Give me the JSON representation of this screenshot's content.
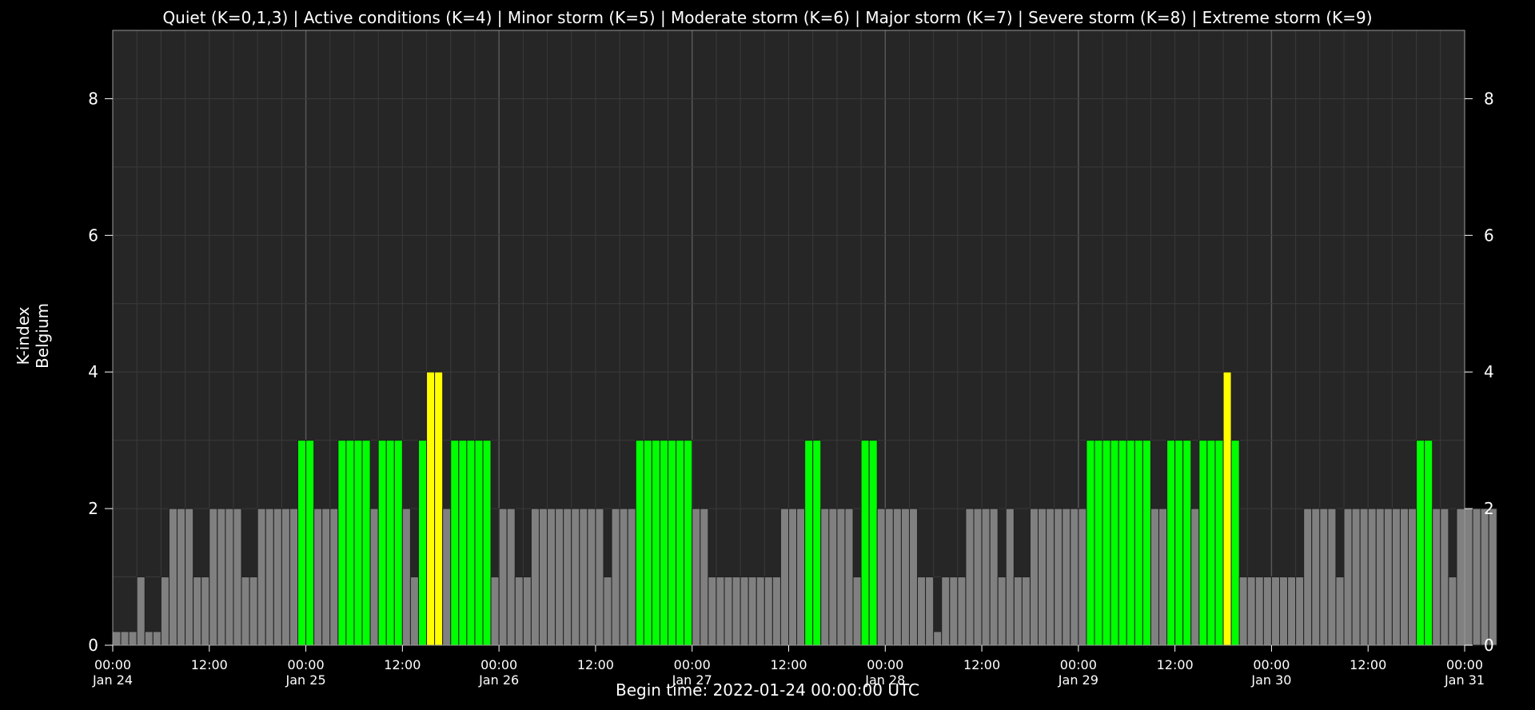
{
  "chart_data": {
    "type": "bar",
    "title": "Quiet (K=0,1,3) | Active conditions (K=4) | Minor storm (K=5) | Moderate storm (K=6) | Major storm (K=7) | Severe storm (K=8) | Extreme storm (K=9)",
    "ylabel_line1": "K-index",
    "ylabel_line2": "Belgium",
    "xlabel": "Begin time: 2022-01-24 00:00:00 UTC",
    "ylim": [
      0,
      9
    ],
    "y_ticks": [
      "0",
      "2",
      "4",
      "6",
      "8"
    ],
    "x_ticks": [
      {
        "time": "00:00",
        "date": "Jan 24"
      },
      {
        "time": "12:00",
        "date": ""
      },
      {
        "time": "00:00",
        "date": "Jan 25"
      },
      {
        "time": "12:00",
        "date": ""
      },
      {
        "time": "00:00",
        "date": "Jan 26"
      },
      {
        "time": "12:00",
        "date": ""
      },
      {
        "time": "00:00",
        "date": "Jan 27"
      },
      {
        "time": "12:00",
        "date": ""
      },
      {
        "time": "00:00",
        "date": "Jan 28"
      },
      {
        "time": "12:00",
        "date": ""
      },
      {
        "time": "00:00",
        "date": "Jan 29"
      },
      {
        "time": "12:00",
        "date": ""
      },
      {
        "time": "00:00",
        "date": "Jan 30"
      },
      {
        "time": "12:00",
        "date": ""
      },
      {
        "time": "00:00",
        "date": "Jan 31"
      }
    ],
    "interval_hours": 1,
    "series": [
      {
        "values": [
          0.2,
          0.2,
          0.2,
          1,
          0.2,
          0.2,
          1,
          2,
          2,
          2,
          1,
          1,
          2,
          2,
          2,
          2,
          1,
          1,
          2,
          2,
          2,
          2,
          2,
          3,
          3,
          2,
          2,
          2,
          3,
          3,
          3,
          3,
          2,
          3,
          3,
          3,
          2,
          1,
          3,
          4,
          4,
          2,
          3,
          3,
          3,
          3,
          3,
          1,
          2,
          2,
          1,
          1,
          2,
          2,
          2,
          2,
          2,
          2,
          2,
          2,
          2,
          1,
          2,
          2,
          2,
          3,
          3,
          3,
          3,
          3,
          3,
          3,
          2,
          2,
          1,
          1,
          1,
          1,
          1,
          1,
          1,
          1,
          1,
          2,
          2,
          2,
          3,
          3,
          2,
          2,
          2,
          2,
          1,
          3,
          3,
          2,
          2,
          2,
          2,
          2,
          1,
          1,
          0.2,
          1,
          1,
          1,
          2,
          2,
          2,
          2,
          1,
          2,
          1,
          1,
          2,
          2,
          2,
          2,
          2,
          2,
          2,
          3,
          3,
          3,
          3,
          3,
          3,
          3,
          3,
          2,
          2,
          3,
          3,
          3,
          2,
          3,
          3,
          3,
          4,
          3,
          1,
          1,
          1,
          1,
          1,
          1,
          1,
          1,
          2,
          2,
          2,
          2,
          1,
          2,
          2,
          2,
          2,
          2,
          2,
          2,
          2,
          2,
          3,
          3,
          2,
          2,
          1,
          2,
          2,
          2,
          2,
          2
        ]
      }
    ],
    "colors": {
      "quiet": "#808080",
      "k3": "#00ff00",
      "active": "#ffff00",
      "plot_bg": "#262626",
      "page_bg": "#000000",
      "grid_minor": "#3a3a3a",
      "grid_major": "#5a5a5a",
      "frame": "#9a9a9a",
      "bar_edge": "#202020"
    },
    "grid": true
  }
}
